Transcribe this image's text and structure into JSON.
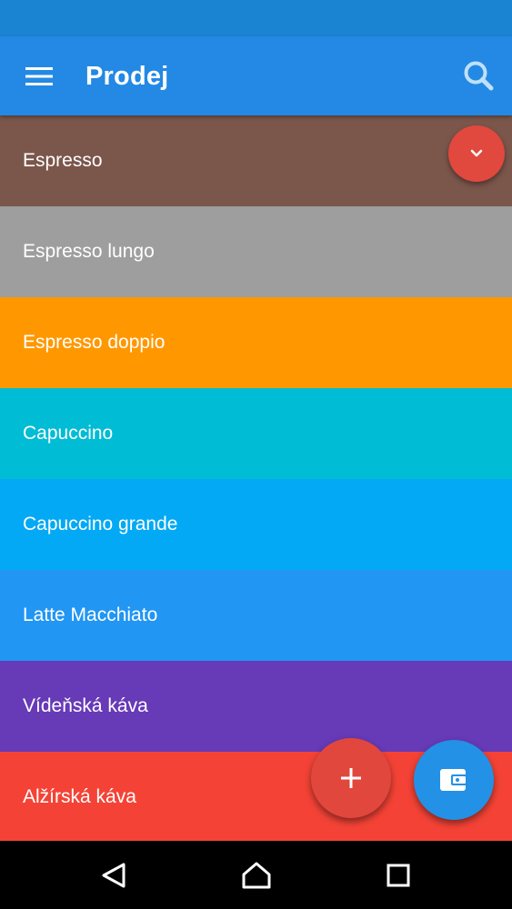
{
  "app_bar": {
    "title": "Prodej",
    "menu_icon": "hamburger-menu-icon",
    "search_icon": "search-icon",
    "color": "#2389e4"
  },
  "status_bar": {
    "color": "#1a84d2"
  },
  "products": [
    {
      "name": "Espresso",
      "color": "#7b564b"
    },
    {
      "name": "Espresso lungo",
      "color": "#9e9e9e"
    },
    {
      "name": "Espresso doppio",
      "color": "#ff9800"
    },
    {
      "name": "Capuccino",
      "color": "#00bcd4"
    },
    {
      "name": "Capuccino grande",
      "color": "#03a9f4"
    },
    {
      "name": "Latte Macchiato",
      "color": "#2196f3"
    },
    {
      "name": "Vídeňská káva",
      "color": "#673ab7"
    },
    {
      "name": "Alžírská káva",
      "color": "#f44336"
    }
  ],
  "fabs": {
    "collapse": {
      "icon": "chevron-down-icon",
      "color": "#e1483e"
    },
    "add": {
      "icon": "plus-icon",
      "color": "#e1473d"
    },
    "wallet": {
      "icon": "wallet-icon",
      "color": "#2391e6"
    }
  },
  "nav_bar": {
    "back_icon": "back-triangle-icon",
    "home_icon": "home-icon",
    "recents_icon": "recents-square-icon"
  }
}
